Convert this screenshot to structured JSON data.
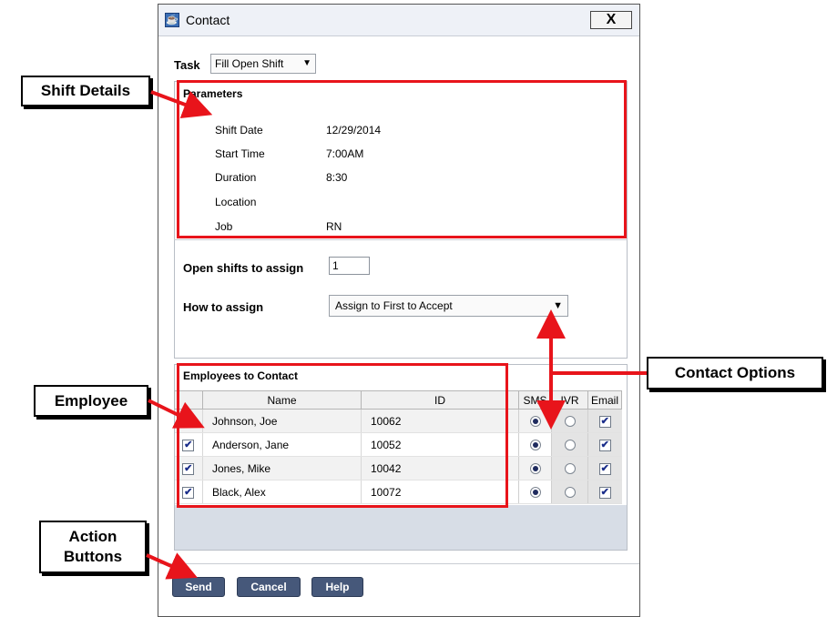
{
  "window": {
    "title": "Contact",
    "close_label": "X"
  },
  "task": {
    "label": "Task",
    "value": "Fill Open Shift"
  },
  "parameters": {
    "title": "Parameters",
    "rows": [
      {
        "label": "Shift Date",
        "value": "12/29/2014"
      },
      {
        "label": "Start Time",
        "value": "7:00AM"
      },
      {
        "label": "Duration",
        "value": "8:30"
      },
      {
        "label": "Location",
        "value": ""
      },
      {
        "label": "Job",
        "value": "RN"
      }
    ]
  },
  "open_shifts": {
    "label": "Open shifts to assign",
    "value": "1"
  },
  "how_to_assign": {
    "label": "How to assign",
    "value": "Assign to First to Accept"
  },
  "employees": {
    "title": "Employees to Contact",
    "columns": {
      "name": "Name",
      "id": "ID",
      "sms": "SMS",
      "ivr": "IVR",
      "email": "Email"
    },
    "rows": [
      {
        "checked": true,
        "name": "Johnson, Joe",
        "id": "10062",
        "sms": true,
        "ivr": false,
        "email": true
      },
      {
        "checked": true,
        "name": "Anderson, Jane",
        "id": "10052",
        "sms": true,
        "ivr": false,
        "email": true
      },
      {
        "checked": true,
        "name": "Jones, Mike",
        "id": "10042",
        "sms": true,
        "ivr": false,
        "email": true
      },
      {
        "checked": true,
        "name": "Black, Alex",
        "id": "10072",
        "sms": true,
        "ivr": false,
        "email": true
      }
    ]
  },
  "buttons": {
    "send": "Send",
    "cancel": "Cancel",
    "help": "Help"
  },
  "callouts": {
    "shift_details": "Shift Details",
    "contact_options": "Contact Options",
    "employee": "Employee",
    "action_buttons_line1": "Action",
    "action_buttons_line2": "Buttons"
  },
  "colors": {
    "annotation_red": "#e8141b",
    "button_bg": "#46587a",
    "titlebar_bg": "#eef1f7"
  }
}
